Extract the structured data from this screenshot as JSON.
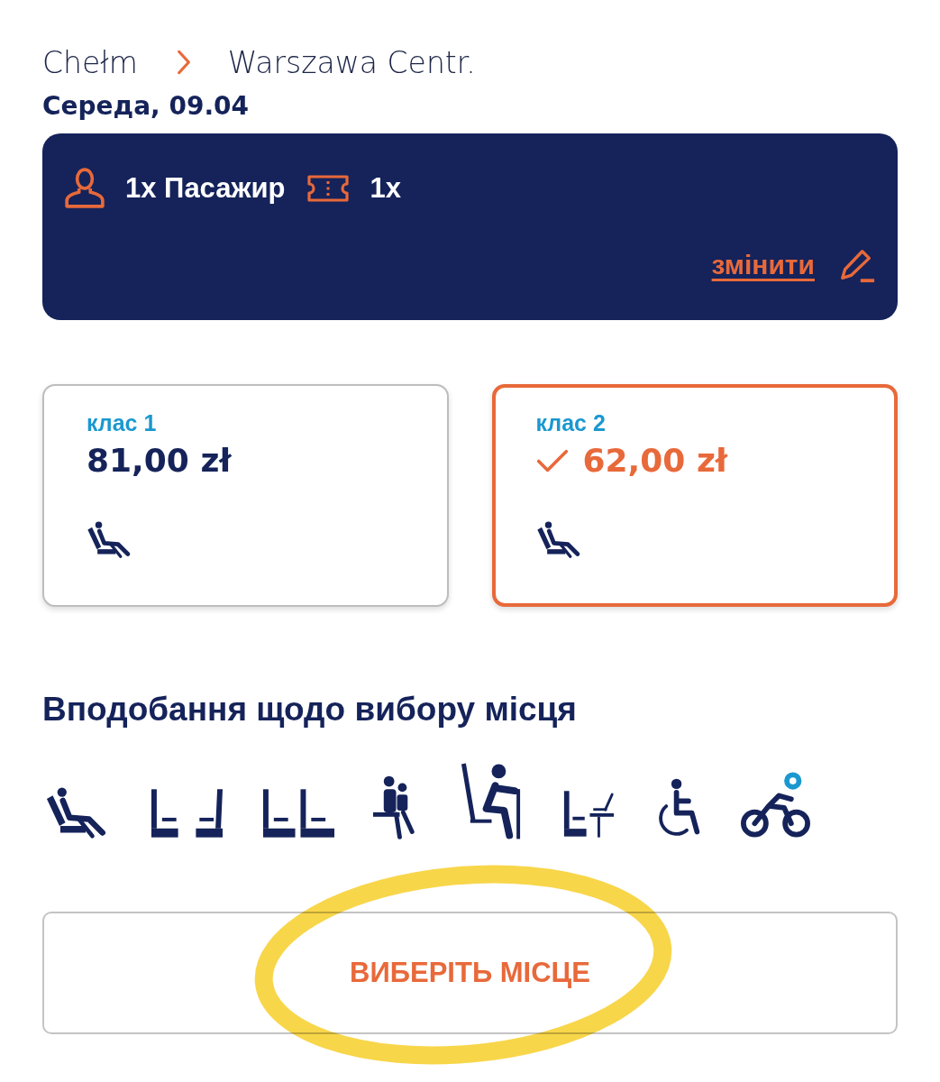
{
  "route": {
    "origin": "Chełm",
    "destination": "Warszawa Centr."
  },
  "date": "Середа, 09.04",
  "booking_summary": {
    "items": [
      {
        "kind": "passenger",
        "text": "1x Пасажир"
      },
      {
        "kind": "ticket",
        "text": "1x"
      }
    ],
    "edit_link": "змінити"
  },
  "classes": [
    {
      "label": "клас 1",
      "price": "81,00 zł",
      "selected": false
    },
    {
      "label": "клас 2",
      "price": "62,00 zł",
      "selected": true
    }
  ],
  "seat_preferences": {
    "title": "Вподобання щодо вибору місця"
  },
  "choose_seat_button": "ВИБЕРІТЬ МІСЦЕ"
}
